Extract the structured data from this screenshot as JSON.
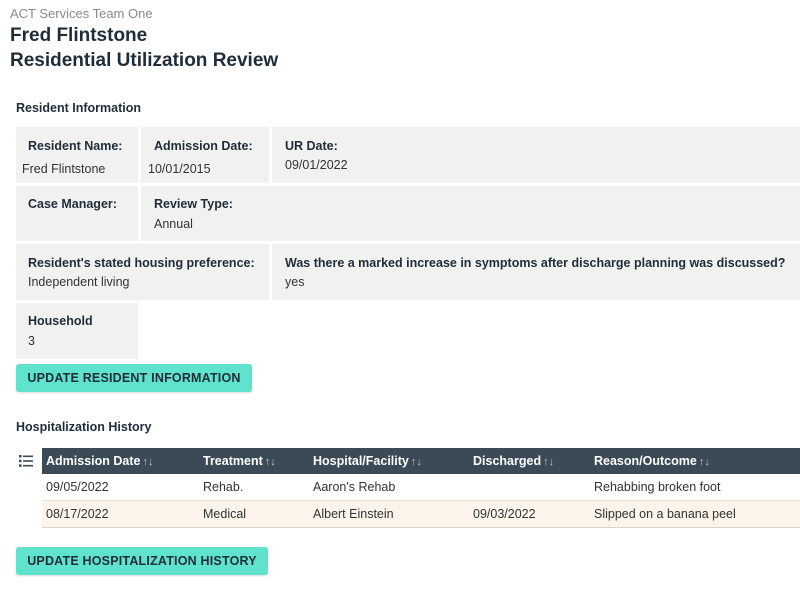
{
  "header": {
    "team": "ACT Services Team One",
    "resident_name": "Fred Flintstone",
    "page_title": "Residential Utilization Review"
  },
  "resident_info": {
    "heading": "Resident Information",
    "resident_name_label": "Resident Name:",
    "resident_name_value": "Fred Flintstone",
    "admission_date_label": "Admission Date:",
    "admission_date_value": "10/01/2015",
    "ur_date_label": "UR Date:",
    "ur_date_value": "09/01/2022",
    "case_manager_label": "Case Manager:",
    "case_manager_value": "",
    "review_type_label": "Review Type:",
    "review_type_value": "Annual",
    "housing_pref_label": "Resident's stated housing preference:",
    "housing_pref_value": "Independent living",
    "symptoms_label": "Was there a marked increase in symptoms after discharge planning was discussed?",
    "symptoms_value": "yes",
    "household_label": "Household",
    "household_value": "3",
    "update_button": "UPDATE RESIDENT INFORMATION"
  },
  "hospitalization": {
    "heading": "Hospitalization History",
    "columns": [
      "Admission Date",
      "Treatment",
      "Hospital/Facility",
      "Discharged",
      "Reason/Outcome"
    ],
    "sort_glyph": "↑↓",
    "rows": [
      [
        "09/05/2022",
        "Rehab.",
        "Aaron's Rehab",
        "",
        "Rehabbing broken foot"
      ],
      [
        "08/17/2022",
        "Medical",
        "Albert Einstein",
        "09/03/2022",
        "Slipped on a banana peel"
      ]
    ],
    "update_button": "UPDATE HOSPITALIZATION HISTORY"
  },
  "colors": {
    "button_bg": "#5fe3cc",
    "table_header_bg": "#3a4a57",
    "cell_bg": "#f1f1f0",
    "alt_row_bg": "#fbf4ea"
  },
  "icons": {
    "table_menu": "list-icon",
    "sort": "sort-icon"
  }
}
